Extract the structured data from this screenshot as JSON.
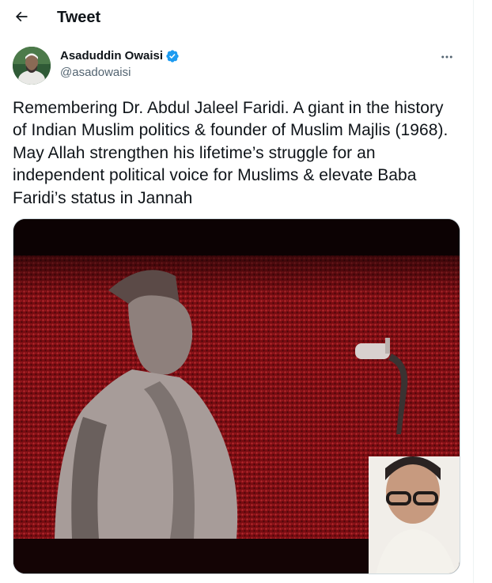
{
  "header": {
    "title": "Tweet"
  },
  "tweet": {
    "author": {
      "display_name": "Asaduddin Owaisi",
      "handle": "@asadowaisi",
      "verified": true
    },
    "text": "Remembering Dr. Abdul Jaleel Faridi. A giant in the history of Indian Muslim politics & founder of Muslim Majlis (1968). May Allah strengthen his lifetime’s struggle for an independent political voice for Muslims & elevate Baba Faridi’s status in Jannah",
    "media": {
      "kind": "photo",
      "description_icon": "photo-icon"
    }
  },
  "icons": {
    "back": "arrow-left-icon",
    "verified": "verified-badge-icon",
    "more": "more-horizontal-icon"
  },
  "colors": {
    "text": "#0f1419",
    "secondary": "#536471",
    "verified": "#1d9bf0",
    "border": "#cfd9de"
  }
}
